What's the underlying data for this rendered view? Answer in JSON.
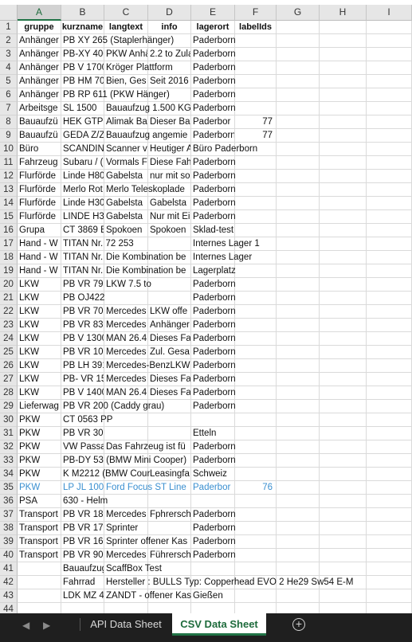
{
  "columns": [
    "A",
    "B",
    "C",
    "D",
    "E",
    "F",
    "G",
    "H",
    "I"
  ],
  "header": {
    "row": "1",
    "cells": [
      "gruppe",
      "kurzname",
      "langtext",
      "info",
      "lagerort",
      "labelIds",
      "",
      "",
      ""
    ]
  },
  "rows": [
    {
      "n": "2",
      "cells": [
        "Anhänger",
        "PB XY 265 (Staplerhänger)",
        "",
        "",
        "Paderborn",
        "",
        "",
        "",
        ""
      ]
    },
    {
      "n": "3",
      "cells": [
        "Anhänger",
        "PB-XY 406",
        "PKW Anhä",
        "2.2 to Zula",
        "Paderborn",
        "",
        "",
        "",
        ""
      ]
    },
    {
      "n": "4",
      "cells": [
        "Anhänger",
        "PB V 1700",
        "Kröger Plattform",
        "",
        "Paderborn",
        "",
        "",
        "",
        ""
      ]
    },
    {
      "n": "5",
      "cells": [
        "Anhänger",
        "PB HM 70",
        "Bien, Ges",
        "Seit 2016",
        "Paderborn",
        "",
        "",
        "",
        ""
      ]
    },
    {
      "n": "6",
      "cells": [
        "Anhänger",
        "PB RP 611 (PKW Hänger)",
        "",
        "",
        "Paderborn",
        "",
        "",
        "",
        ""
      ]
    },
    {
      "n": "7",
      "cells": [
        "Arbeitsge",
        "SL 1500",
        "Bauaufzug 1.500 KG",
        "",
        "Paderborn",
        "",
        "",
        "",
        ""
      ]
    },
    {
      "n": "8",
      "cells": [
        "Bauaufzü",
        "HEK GTP 1",
        "Alimak Ba",
        "Dieser Ba",
        "Paderbor",
        "77",
        "",
        "",
        ""
      ]
    },
    {
      "n": "9",
      "cells": [
        "Bauaufzü",
        "GEDA Z/Z",
        "Bauaufzug angemie",
        "",
        "Paderborn",
        "77",
        "",
        "",
        ""
      ]
    },
    {
      "n": "10",
      "cells": [
        "Büro",
        "SCANDINA",
        "Scanner v",
        "Heutiger A",
        "Büro Paderborn",
        "",
        "",
        "",
        ""
      ]
    },
    {
      "n": "11",
      "cells": [
        "Fahrzeug",
        "Subaru / (",
        "Vormals F",
        "Diese Fah",
        "Paderborn",
        "",
        "",
        "",
        ""
      ]
    },
    {
      "n": "12",
      "cells": [
        "Flurförde",
        "Linde H80",
        "Gabelsta",
        "nur mit so",
        "Paderborn",
        "",
        "",
        "",
        ""
      ]
    },
    {
      "n": "13",
      "cells": [
        "Flurförde",
        "Merlo Rot",
        "Merlo Teleskoplade",
        "",
        "Paderborn",
        "",
        "",
        "",
        ""
      ]
    },
    {
      "n": "14",
      "cells": [
        "Flurförde",
        "Linde H30",
        "Gabelsta",
        "Gabelsta",
        "Paderborn",
        "",
        "",
        "",
        ""
      ]
    },
    {
      "n": "15",
      "cells": [
        "Flurförde",
        "LINDE H30",
        "Gabelsta",
        "Nur mit Ei",
        "Paderborn",
        "",
        "",
        "",
        ""
      ]
    },
    {
      "n": "16",
      "cells": [
        "Grupa",
        "CT 3869 B",
        "Spokoen",
        "Spokoen",
        "Sklad-test",
        "",
        "",
        "",
        ""
      ]
    },
    {
      "n": "17",
      "cells": [
        "Hand - W",
        "TITAN Nr. 72 253",
        "",
        "",
        "Internes Lager 1",
        "",
        "",
        "",
        ""
      ]
    },
    {
      "n": "18",
      "cells": [
        "Hand - W",
        "TITAN Nr.",
        "Die Kombination be",
        "",
        "Internes Lager",
        "",
        "",
        "",
        ""
      ]
    },
    {
      "n": "19",
      "cells": [
        "Hand - W",
        "TITAN Nr.",
        "Die Kombination be",
        "",
        "Lagerplatz",
        "",
        "",
        "",
        ""
      ]
    },
    {
      "n": "20",
      "cells": [
        "LKW",
        "PB VR 79 (",
        "LKW 7.5 to",
        "",
        "Paderborn",
        "",
        "",
        "",
        ""
      ]
    },
    {
      "n": "21",
      "cells": [
        "LKW",
        "PB OJ422",
        "",
        "",
        "Paderborn",
        "",
        "",
        "",
        ""
      ]
    },
    {
      "n": "22",
      "cells": [
        "LKW",
        "PB VR 70 (",
        "Mercedes",
        "LKW offe",
        "Paderborn",
        "",
        "",
        "",
        ""
      ]
    },
    {
      "n": "23",
      "cells": [
        "LKW",
        "PB VR 83",
        "Mercedes",
        "Anhänger",
        "Paderborn",
        "",
        "",
        "",
        ""
      ]
    },
    {
      "n": "24",
      "cells": [
        "LKW",
        "PB V 1300",
        "MAN 26.4",
        "Dieses Fa",
        "Paderborn",
        "",
        "",
        "",
        ""
      ]
    },
    {
      "n": "25",
      "cells": [
        "LKW",
        "PB VR 10",
        "Mercedes",
        "Zul. Gesa",
        "Paderborn",
        "",
        "",
        "",
        ""
      ]
    },
    {
      "n": "26",
      "cells": [
        "LKW",
        "PB LH 391",
        "Mercedes-BenzLKW",
        "",
        "Paderborn",
        "",
        "",
        "",
        ""
      ]
    },
    {
      "n": "27",
      "cells": [
        "LKW",
        "PB- VR 15",
        "Mercedes",
        "Dieses Fa",
        "Paderborn",
        "",
        "",
        "",
        ""
      ]
    },
    {
      "n": "28",
      "cells": [
        "LKW",
        "PB V 1400",
        "MAN 26.4",
        "Dieses Fa",
        "Paderborn",
        "",
        "",
        "",
        ""
      ]
    },
    {
      "n": "29",
      "cells": [
        "Lieferwag",
        "PB VR 200 (Caddy grau)",
        "",
        "",
        "Paderborn",
        "",
        "",
        "",
        ""
      ]
    },
    {
      "n": "30",
      "cells": [
        "PKW",
        "CT 0563 PP",
        "",
        "",
        "",
        "",
        "",
        "",
        ""
      ]
    },
    {
      "n": "31",
      "cells": [
        "PKW",
        "PB VR 30",
        "",
        "",
        "Etteln",
        "",
        "",
        "",
        ""
      ]
    },
    {
      "n": "32",
      "cells": [
        "PKW",
        "VW Passa",
        "Das Fahrzeug ist fü",
        "",
        "Paderborn",
        "",
        "",
        "",
        ""
      ]
    },
    {
      "n": "33",
      "cells": [
        "PKW",
        "PB-DY 53 (BMW Mini Cooper)",
        "",
        "",
        "Paderborn",
        "",
        "",
        "",
        ""
      ]
    },
    {
      "n": "34",
      "cells": [
        "PKW",
        "K M2212 (BMW Cour",
        "",
        "Leasingfa",
        "Schweiz",
        "",
        "",
        "",
        ""
      ]
    },
    {
      "n": "35",
      "cells": [
        "PKW",
        "LP JL 1000",
        "Ford Focus ST Line",
        "",
        "Paderbor",
        "76",
        "",
        "",
        ""
      ]
    },
    {
      "n": "36",
      "cells": [
        "PSA",
        "630 - Helm",
        "",
        "",
        "",
        "",
        "",
        "",
        ""
      ]
    },
    {
      "n": "37",
      "cells": [
        "Transport",
        "PB VR 180",
        "Mercedes",
        "Fphrersch",
        "Paderborn",
        "",
        "",
        "",
        ""
      ]
    },
    {
      "n": "38",
      "cells": [
        "Transport",
        "PB VR 170",
        "Sprinter",
        "",
        "Paderborn",
        "",
        "",
        "",
        ""
      ]
    },
    {
      "n": "39",
      "cells": [
        "Transport",
        "PB VR 160",
        "Sprinter offener Kas",
        "",
        "Paderborn",
        "",
        "",
        "",
        ""
      ]
    },
    {
      "n": "40",
      "cells": [
        "Transport",
        "PB VR 900",
        "Mercedes",
        "Führersch",
        "Paderborn",
        "",
        "",
        "",
        ""
      ]
    },
    {
      "n": "41",
      "cells": [
        "",
        "Bauaufzug",
        "ScaffBox Test",
        "",
        "",
        "",
        "",
        "",
        ""
      ]
    },
    {
      "n": "42",
      "cells": [
        "",
        "Fahrrad",
        "Hersteller : BULLS Typ: Copperhead EVO 2 He29 Sw54 E-M",
        "",
        "",
        "",
        "",
        "",
        ""
      ]
    },
    {
      "n": "43",
      "cells": [
        "",
        "LDK MZ 43",
        "ZANDT - offener Kas",
        "",
        "Gießen",
        "",
        "",
        "",
        ""
      ]
    },
    {
      "n": "44",
      "cells": [
        "",
        "",
        "",
        "",
        "",
        "",
        "",
        "",
        ""
      ]
    }
  ],
  "highlight_row": "35",
  "tabs": {
    "left_nav": "◀",
    "right_nav": "▶",
    "api": "API Data Sheet",
    "csv": "CSV Data Sheet",
    "add": "+"
  },
  "colors": {
    "accent": "#217346",
    "highlight_text": "#3a8fd0",
    "tab_bar": "#1f1f1f"
  }
}
